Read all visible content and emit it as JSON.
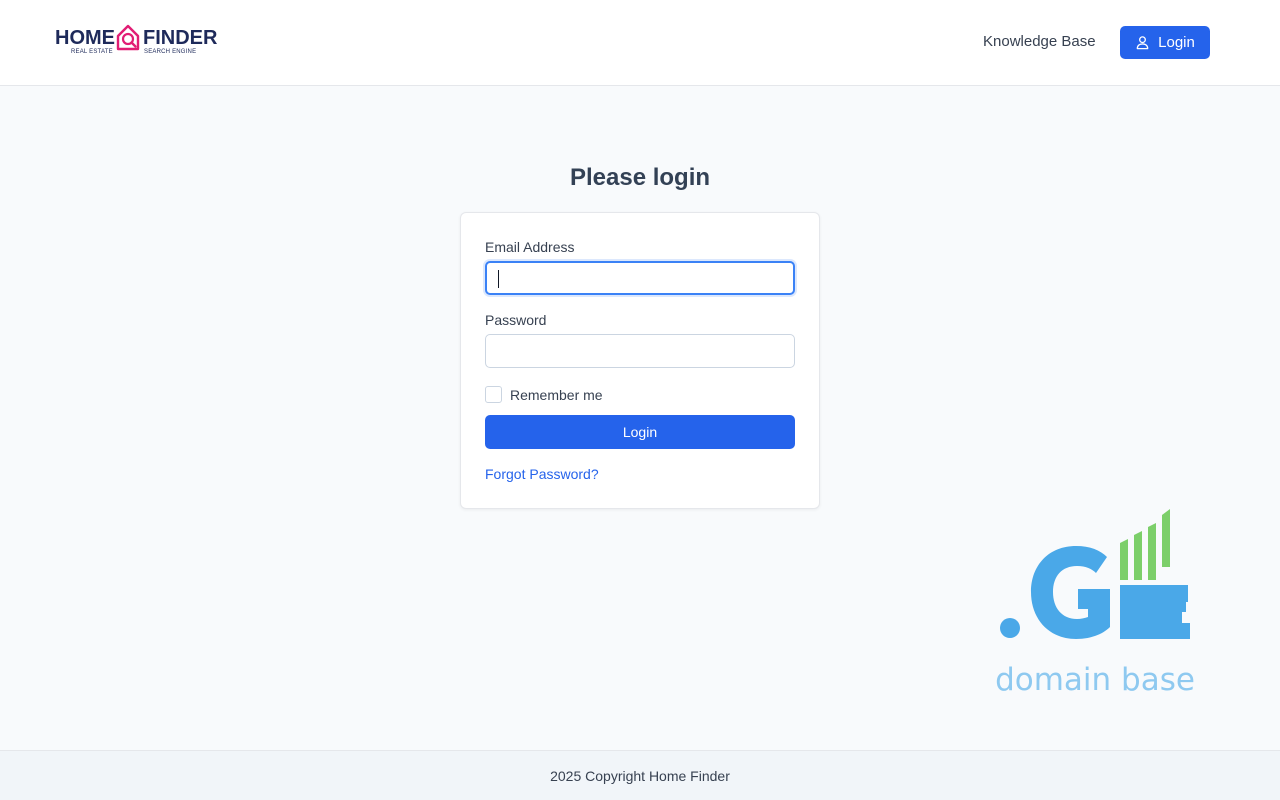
{
  "header": {
    "logo": {
      "word_left": "HOME",
      "word_right": "FINDER",
      "sub_left": "REAL ESTATE",
      "sub_right": "SEARCH ENGINE"
    },
    "nav_link": "Knowledge Base",
    "login_button": "Login",
    "login_icon": "user-icon"
  },
  "main": {
    "title": "Please login",
    "form": {
      "email_label": "Email Address",
      "email_value": "",
      "password_label": "Password",
      "password_value": "",
      "remember_label": "Remember me",
      "remember_checked": false,
      "submit_label": "Login",
      "forgot_link": "Forgot Password?"
    }
  },
  "watermark": {
    "mark": ".GE",
    "caption": "domain base"
  },
  "footer": {
    "copyright": "2025 Copyright Home Finder"
  },
  "colors": {
    "primary": "#2563eb",
    "logo_navy": "#1e2a5a",
    "logo_pink": "#e11d74",
    "ge_blue": "#4aa8e8",
    "ge_green": "#7ccf6a",
    "ge_caption": "#8ec9f0"
  }
}
